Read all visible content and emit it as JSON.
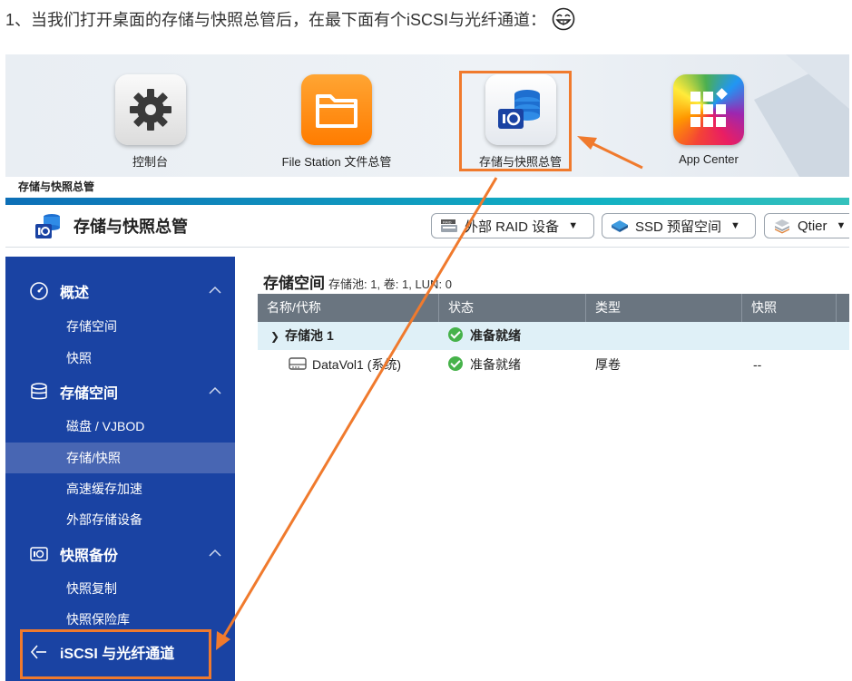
{
  "intro": {
    "text": "1、当我们打开桌面的存储与快照总管后，在最下面有个iSCSI与光纤通道："
  },
  "desktop": {
    "apps": [
      {
        "label": "控制台",
        "icon": "gear-icon"
      },
      {
        "label": "File Station 文件总管",
        "icon": "folder-icon"
      },
      {
        "label": "存储与快照总管",
        "icon": "storage-icon"
      },
      {
        "label": "App Center",
        "icon": "app-grid-icon"
      }
    ]
  },
  "window": {
    "title": "存储与快照总管",
    "app_name": "存储与快照总管",
    "toolbar": {
      "raid_label": "外部 RAID 设备",
      "ssd_label": "SSD 预留空间",
      "qtier_label": "Qtier"
    }
  },
  "sidebar": {
    "sections": [
      {
        "label": "概述",
        "icon": "dashboard-icon",
        "items": [
          "存储空间",
          "快照"
        ]
      },
      {
        "label": "存储空间",
        "icon": "database-icon",
        "items": [
          "磁盘 / VJBOD",
          "存储/快照",
          "高速缓存加速",
          "外部存储设备"
        ]
      },
      {
        "label": "快照备份",
        "icon": "snapshot-icon",
        "items": [
          "快照复制",
          "快照保险库"
        ]
      }
    ],
    "selected_item": "存储/快照",
    "iscsi_label": "iSCSI 与光纤通道"
  },
  "content": {
    "title": "存储空间",
    "pool_label": "存储池:",
    "pool_count": "1",
    "volume_label": "卷:",
    "volume_count": "1",
    "lun_label": "LUN:",
    "lun_count": "0",
    "columns": [
      "名称/代称",
      "状态",
      "类型",
      "快照"
    ],
    "rows": [
      {
        "name": "存储池 1",
        "status": "准备就绪",
        "type": "",
        "snapshot": ""
      },
      {
        "name": "DataVol1 (系统)",
        "status": "准备就绪",
        "type": "厚卷",
        "snapshot": "--"
      }
    ]
  },
  "colors": {
    "sidebar": "#1a43a3",
    "highlight": "#f07a2d",
    "status_ok": "#46b24a",
    "table_header": "#6a7580"
  }
}
